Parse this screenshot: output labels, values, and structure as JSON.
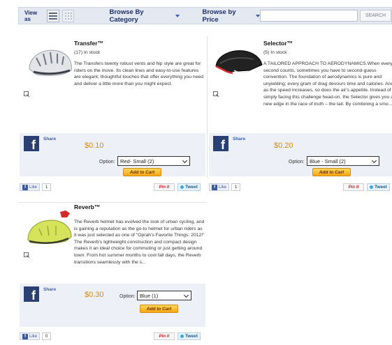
{
  "toolbar": {
    "view_as": "View as",
    "browse_category": "Browse By Category",
    "browse_price": "Browse by Price",
    "search_placeholder": "",
    "search_button": "SEARCH"
  },
  "products": [
    {
      "name": "Transfer™",
      "stock": "(17) In stock",
      "description": "The Transfers twenty robust vents and hip style are great for riders on the move. Its clean lines and easy-to-use features are elegant, thoughtful touches that offer everything you need and deliver a little more than you might expect.",
      "share": "Share",
      "price": "$0.10",
      "option_label": "Option:",
      "option_value": "Red- Small (2)",
      "add_to_cart": "Add to Cart",
      "like": "Like",
      "like_count": "1",
      "pin": "Pin it",
      "tweet": "Tweet",
      "helmet_color": "#e2e4e8"
    },
    {
      "name": "Selector™",
      "stock": "(5) In stock",
      "description": "A TAILORED APPROACH TO AERODYNAMICS.When every second counts, sometimes you have to second-guess convention. The foundation of aerodynamics is pure and unyielding; every gram of drag devours time and calories. And as the speed increases, so does the air's appetite. Instead of simply facing this challenge head-on, the Selector gives you a new edge in the race of truth – the tail. By combining a smo...",
      "share": "Share",
      "price": "$0.20",
      "option_label": "Option:",
      "option_value": "Blue - Small (2)",
      "add_to_cart": "Add to Cart",
      "like": "Like",
      "like_count": "1",
      "pin": "Pin it",
      "tweet": "Tweet",
      "helmet_color": "#222222"
    },
    {
      "name": "Reverb™",
      "stock": "",
      "description": "The Reverb helmet has evolved the look of urban cycling, and is gaining a reputation as the go-to helmet for urban riders as it was just selected as one of \"Oprah's Favorite Things: 2012!\" The Reverb's lightweight construction and compact design makes it an ideal choice for commuting or just getting around town. From hot summer months to cool fall days, the Reverb transitions seamlessly with the s...",
      "share": "Share",
      "price": "$0.30",
      "option_label": "Option:",
      "option_value": "Blue (1)",
      "add_to_cart": "Add to Cart",
      "like": "Like",
      "like_count": "0",
      "pin": "Pin it",
      "tweet": "Tweet",
      "helmet_color": "#d4e35a"
    }
  ],
  "colors": {
    "accent_price": "#d38b14",
    "nav_text": "#1c2f6b",
    "buy_bg": "#edf1f7"
  }
}
